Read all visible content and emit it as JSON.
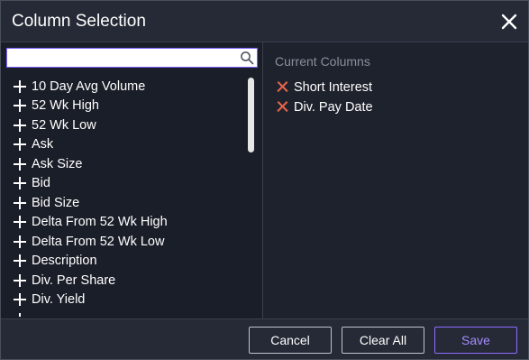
{
  "dialog": {
    "title": "Column Selection",
    "close_icon": "close-icon"
  },
  "search": {
    "value": "",
    "placeholder": "",
    "icon": "search-icon"
  },
  "available": {
    "add_icon": "plus-icon",
    "items": [
      {
        "label": "10 Day Avg Volume"
      },
      {
        "label": "52 Wk High"
      },
      {
        "label": "52 Wk Low"
      },
      {
        "label": "Ask"
      },
      {
        "label": "Ask Size"
      },
      {
        "label": "Bid"
      },
      {
        "label": "Bid Size"
      },
      {
        "label": "Delta From 52 Wk High"
      },
      {
        "label": "Delta From 52 Wk Low"
      },
      {
        "label": "Description"
      },
      {
        "label": "Div. Per Share"
      },
      {
        "label": "Div. Yield"
      }
    ]
  },
  "current": {
    "heading": "Current Columns",
    "remove_icon": "remove-x-icon",
    "items": [
      {
        "label": "Short Interest"
      },
      {
        "label": "Div. Pay Date"
      }
    ]
  },
  "footer": {
    "cancel_label": "Cancel",
    "clear_label": "Clear All",
    "save_label": "Save"
  },
  "colors": {
    "background": "#1e222d",
    "accent": "#8e6cff",
    "remove": "#e8654a"
  }
}
